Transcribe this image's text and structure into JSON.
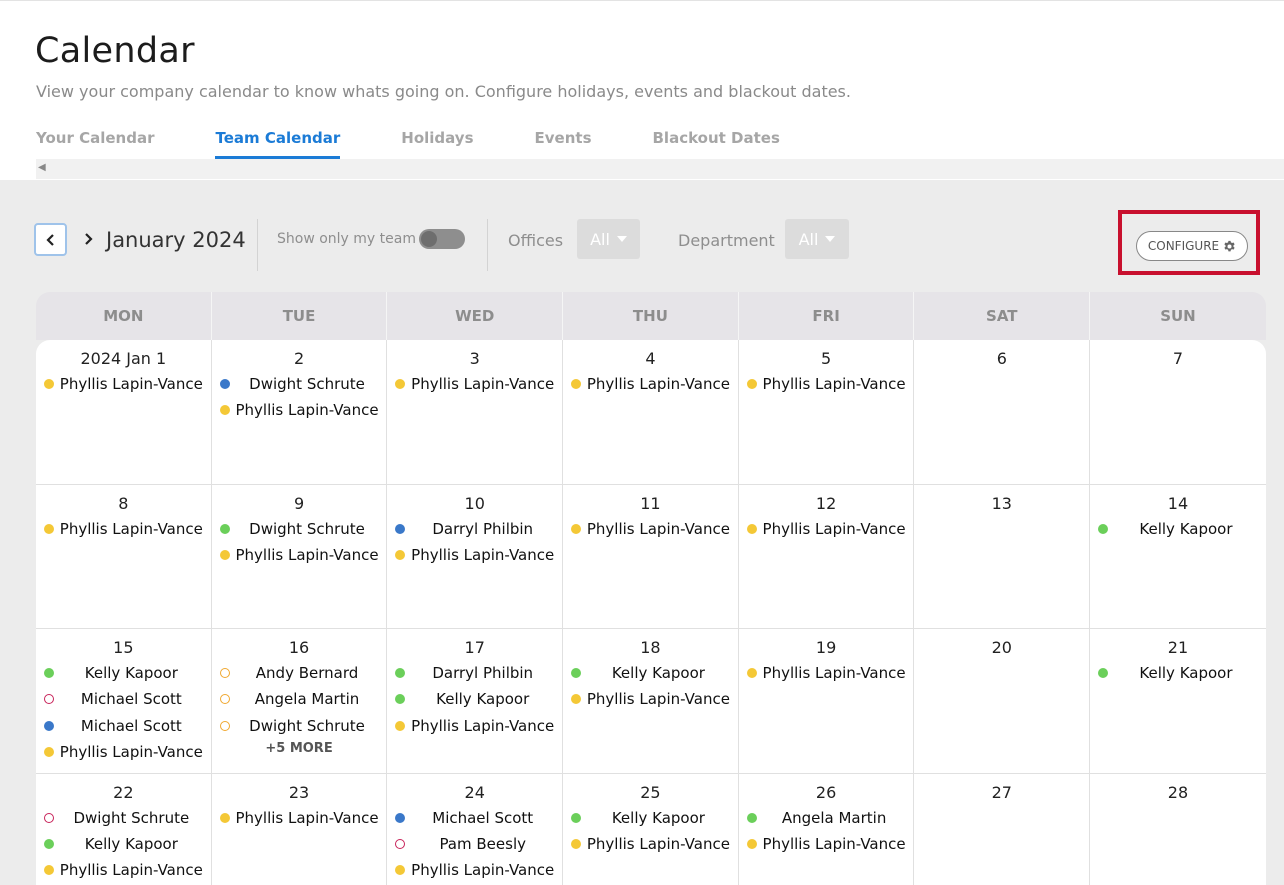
{
  "header": {
    "title": "Calendar",
    "subtitle": "View your company calendar to know whats going on. Configure holidays, events and blackout dates.",
    "tabs": [
      {
        "label": "Your Calendar",
        "active": false
      },
      {
        "label": "Team Calendar",
        "active": true
      },
      {
        "label": "Holidays",
        "active": false
      },
      {
        "label": "Events",
        "active": false
      },
      {
        "label": "Blackout Dates",
        "active": false
      }
    ]
  },
  "toolbar": {
    "month": "January 2024",
    "show_team_label": "Show only my team",
    "show_team_on": false,
    "offices_label": "Offices",
    "offices_value": "All",
    "department_label": "Department",
    "department_value": "All",
    "configure_label": "CONFIGURE"
  },
  "calendar": {
    "weekdays": [
      "MON",
      "TUE",
      "WED",
      "THU",
      "FRI",
      "SAT",
      "SUN"
    ],
    "weeks": [
      [
        {
          "day": "2024 Jan 1",
          "entries": [
            {
              "name": "Phyllis Lapin-Vance",
              "dot": "yellow"
            }
          ]
        },
        {
          "day": "2",
          "entries": [
            {
              "name": "Dwight Schrute",
              "dot": "blue"
            },
            {
              "name": "Phyllis Lapin-Vance",
              "dot": "yellow"
            }
          ]
        },
        {
          "day": "3",
          "entries": [
            {
              "name": "Phyllis Lapin-Vance",
              "dot": "yellow"
            }
          ]
        },
        {
          "day": "4",
          "entries": [
            {
              "name": "Phyllis Lapin-Vance",
              "dot": "yellow"
            }
          ]
        },
        {
          "day": "5",
          "entries": [
            {
              "name": "Phyllis Lapin-Vance",
              "dot": "yellow"
            }
          ]
        },
        {
          "day": "6",
          "entries": []
        },
        {
          "day": "7",
          "entries": []
        }
      ],
      [
        {
          "day": "8",
          "entries": [
            {
              "name": "Phyllis Lapin-Vance",
              "dot": "yellow"
            }
          ]
        },
        {
          "day": "9",
          "entries": [
            {
              "name": "Dwight Schrute",
              "dot": "green"
            },
            {
              "name": "Phyllis Lapin-Vance",
              "dot": "yellow"
            }
          ]
        },
        {
          "day": "10",
          "entries": [
            {
              "name": "Darryl Philbin",
              "dot": "blue"
            },
            {
              "name": "Phyllis Lapin-Vance",
              "dot": "yellow"
            }
          ]
        },
        {
          "day": "11",
          "entries": [
            {
              "name": "Phyllis Lapin-Vance",
              "dot": "yellow"
            }
          ]
        },
        {
          "day": "12",
          "entries": [
            {
              "name": "Phyllis Lapin-Vance",
              "dot": "yellow"
            }
          ]
        },
        {
          "day": "13",
          "entries": []
        },
        {
          "day": "14",
          "entries": [
            {
              "name": "Kelly Kapoor",
              "dot": "green"
            }
          ]
        }
      ],
      [
        {
          "day": "15",
          "entries": [
            {
              "name": "Kelly Kapoor",
              "dot": "green"
            },
            {
              "name": "Michael Scott",
              "dot": "ring-pink"
            },
            {
              "name": "Michael Scott",
              "dot": "blue"
            },
            {
              "name": "Phyllis Lapin-Vance",
              "dot": "yellow"
            }
          ]
        },
        {
          "day": "16",
          "entries": [
            {
              "name": "Andy Bernard",
              "dot": "ring-orange"
            },
            {
              "name": "Angela Martin",
              "dot": "ring-orange"
            },
            {
              "name": "Dwight Schrute",
              "dot": "ring-orange"
            }
          ],
          "more": "+5 MORE"
        },
        {
          "day": "17",
          "entries": [
            {
              "name": "Darryl Philbin",
              "dot": "green"
            },
            {
              "name": "Kelly Kapoor",
              "dot": "green"
            },
            {
              "name": "Phyllis Lapin-Vance",
              "dot": "yellow"
            }
          ]
        },
        {
          "day": "18",
          "entries": [
            {
              "name": "Kelly Kapoor",
              "dot": "green"
            },
            {
              "name": "Phyllis Lapin-Vance",
              "dot": "yellow"
            }
          ]
        },
        {
          "day": "19",
          "entries": [
            {
              "name": "Phyllis Lapin-Vance",
              "dot": "yellow"
            }
          ]
        },
        {
          "day": "20",
          "entries": []
        },
        {
          "day": "21",
          "entries": [
            {
              "name": "Kelly Kapoor",
              "dot": "green"
            }
          ]
        }
      ],
      [
        {
          "day": "22",
          "entries": [
            {
              "name": "Dwight Schrute",
              "dot": "ring-pink"
            },
            {
              "name": "Kelly Kapoor",
              "dot": "green"
            },
            {
              "name": "Phyllis Lapin-Vance",
              "dot": "yellow"
            }
          ]
        },
        {
          "day": "23",
          "entries": [
            {
              "name": "Phyllis Lapin-Vance",
              "dot": "yellow"
            }
          ]
        },
        {
          "day": "24",
          "entries": [
            {
              "name": "Michael Scott",
              "dot": "blue"
            },
            {
              "name": "Pam Beesly",
              "dot": "ring-pink"
            },
            {
              "name": "Phyllis Lapin-Vance",
              "dot": "yellow"
            }
          ]
        },
        {
          "day": "25",
          "entries": [
            {
              "name": "Kelly Kapoor",
              "dot": "green"
            },
            {
              "name": "Phyllis Lapin-Vance",
              "dot": "yellow"
            }
          ]
        },
        {
          "day": "26",
          "entries": [
            {
              "name": "Angela Martin",
              "dot": "green"
            },
            {
              "name": "Phyllis Lapin-Vance",
              "dot": "yellow"
            }
          ]
        },
        {
          "day": "27",
          "entries": []
        },
        {
          "day": "28",
          "entries": []
        }
      ]
    ]
  },
  "colors": {
    "accent": "#1b7bd6",
    "highlight_frame": "#c8102e",
    "dot_yellow": "#f4c836",
    "dot_blue": "#3a78c9",
    "dot_green": "#6bcf5a",
    "ring_orange": "#f0a830",
    "ring_pink": "#c8235a"
  }
}
